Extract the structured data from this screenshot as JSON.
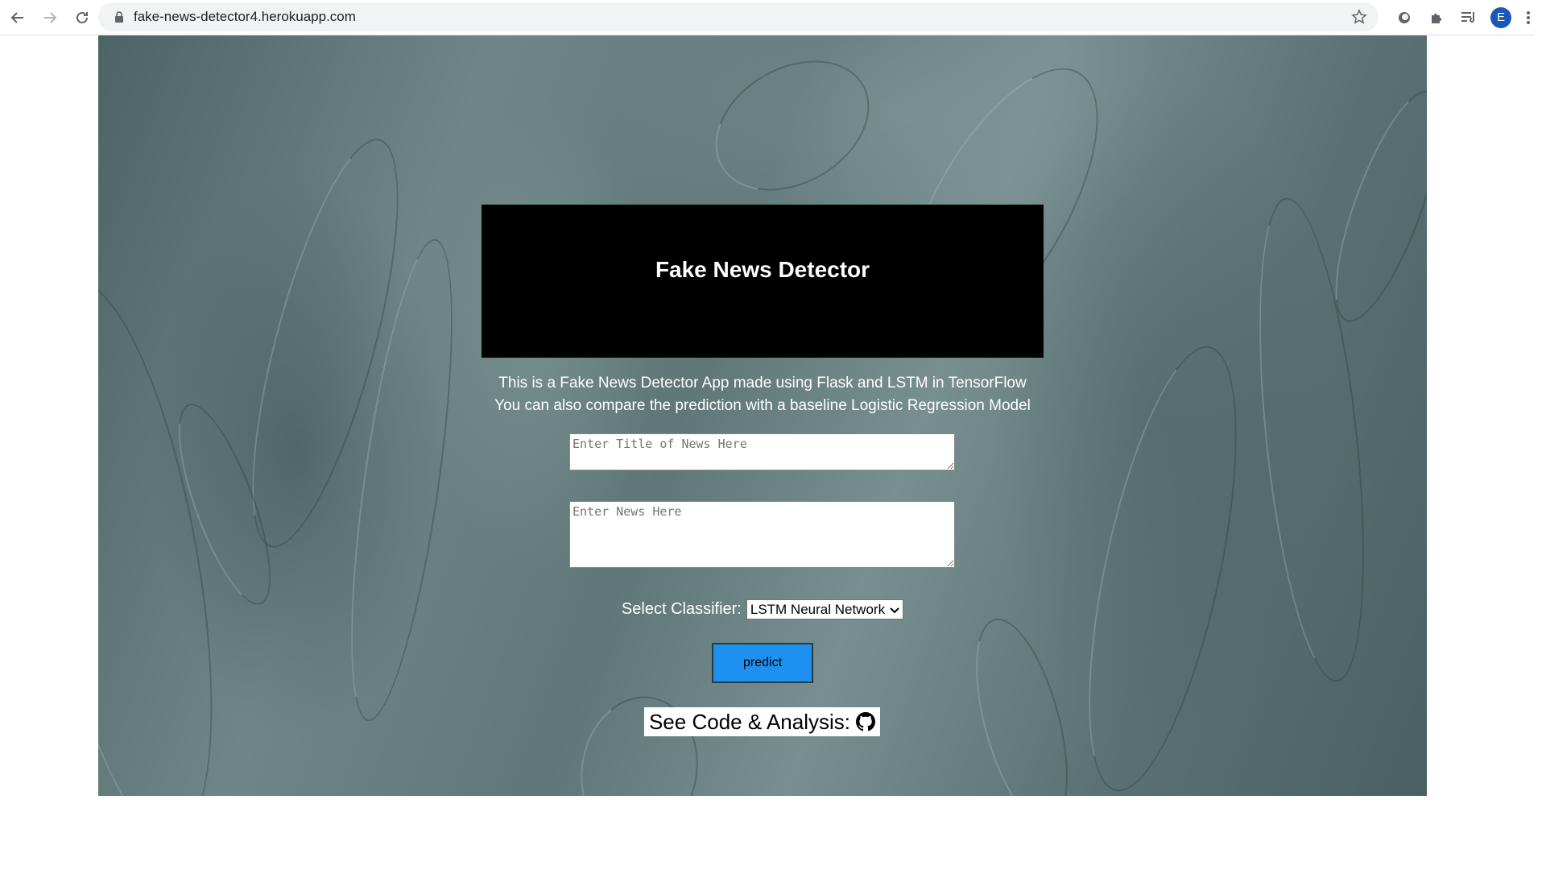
{
  "browser": {
    "url": "fake-news-detector4.herokuapp.com",
    "profile_initial": "E",
    "icons": [
      "back-arrow-icon",
      "forward-arrow-icon",
      "reload-icon",
      "lock-icon",
      "star-icon",
      "extension-circle-icon",
      "puzzle-icon",
      "reading-list-icon",
      "menu-dots-icon"
    ]
  },
  "app": {
    "title": "Fake News Detector",
    "description_line1": "This is a Fake News Detector App made using Flask and LSTM in TensorFlow",
    "description_line2": "You can also compare the prediction with a baseline Logistic Regression Model",
    "title_placeholder": "Enter Title of News Here",
    "news_placeholder": "Enter News Here",
    "classifier_label": "Select Classifier:",
    "classifier_selected": "LSTM Neural Network",
    "predict_label": "predict",
    "code_link_label": "See Code & Analysis:"
  },
  "colors": {
    "title_bg": "#000000",
    "predict_bg": "#1e90f0",
    "avatar_bg": "#1a57b8"
  }
}
